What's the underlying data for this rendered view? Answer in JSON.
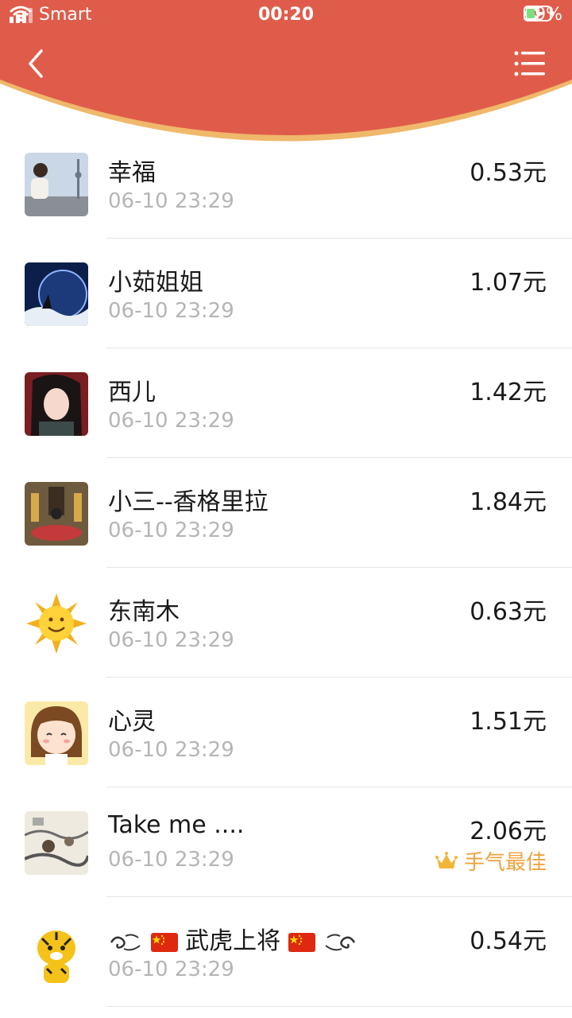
{
  "status_bar": {
    "carrier": "Smart",
    "time": "00:20",
    "battery": "29%"
  },
  "colors": {
    "header_red": "#e05c4a",
    "accent_gold": "#efa23c",
    "divider": "#e6e6e6"
  },
  "icons": {
    "back": "chevron-left-icon",
    "menu": "list-menu-icon",
    "best": "crown-icon"
  },
  "list": {
    "items": [
      {
        "name": "幸福",
        "time": "06-10 23:29",
        "amount": "0.53元"
      },
      {
        "name": "小茹姐姐",
        "time": "06-10 23:29",
        "amount": "1.07元"
      },
      {
        "name": "西儿",
        "time": "06-10 23:29",
        "amount": "1.42元"
      },
      {
        "name": "小三--香格里拉",
        "time": "06-10 23:29",
        "amount": "1.84元"
      },
      {
        "name": "东南木",
        "time": "06-10 23:29",
        "amount": "0.63元"
      },
      {
        "name": "心灵",
        "time": "06-10 23:29",
        "amount": "1.51元"
      },
      {
        "name": "Take me ....",
        "time": "06-10 23:29",
        "amount": "2.06元",
        "badge": "手气最佳"
      },
      {
        "name": "武虎上将",
        "time": "06-10 23:29",
        "amount": "0.54元"
      }
    ]
  }
}
